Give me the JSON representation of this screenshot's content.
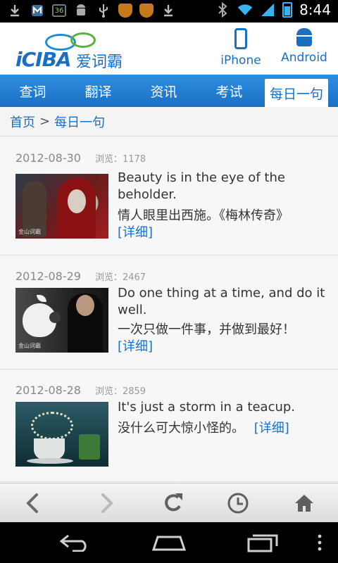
{
  "status_bar": {
    "time": "8:44",
    "notification_icons": [
      "download-icon",
      "mail-icon",
      "battery-36-icon",
      "android-icon",
      "usb-icon",
      "shield-icon",
      "shield-icon",
      "download-icon"
    ],
    "battery_text": "36"
  },
  "header": {
    "logo_text": "iCIBA",
    "logo_cn": "爱词霸",
    "platforms": [
      {
        "label": "iPhone",
        "icon": "iphone-icon"
      },
      {
        "label": "Android",
        "icon": "android-icon"
      }
    ]
  },
  "nav": {
    "items": [
      {
        "label": "查词",
        "active": false
      },
      {
        "label": "翻译",
        "active": false
      },
      {
        "label": "资讯",
        "active": false
      },
      {
        "label": "考试",
        "active": false
      },
      {
        "label": "每日一句",
        "active": true
      }
    ]
  },
  "breadcrumb": {
    "home": "首页",
    "separator": ">",
    "current": "每日一句"
  },
  "entries": [
    {
      "date": "2012-08-30",
      "views_label": "浏览：1178",
      "en": "Beauty is in the eye of the beholder.",
      "cn": "情人眼里出西施。《梅林传奇》",
      "more": "[详细]",
      "watermark": "金山词霸"
    },
    {
      "date": "2012-08-29",
      "views_label": "浏览：2467",
      "en": "Do one thing at a time, and do it well.",
      "cn": "一次只做一件事，并做到最好！",
      "more": "[详细]",
      "watermark": "金山词霸"
    },
    {
      "date": "2012-08-28",
      "views_label": "浏览：2859",
      "en": "It's just a storm in a teacup.",
      "cn": "没什么可大惊小怪的。",
      "more": "[详细]",
      "watermark": ""
    }
  ],
  "toolbar": {
    "buttons": [
      "back-icon",
      "forward-icon",
      "refresh-icon",
      "history-icon",
      "home-icon"
    ]
  },
  "colors": {
    "brand_blue": "#1b6fc2",
    "nav_gradient_top": "#2f8fe0",
    "nav_gradient_bottom": "#1a6fc4"
  }
}
